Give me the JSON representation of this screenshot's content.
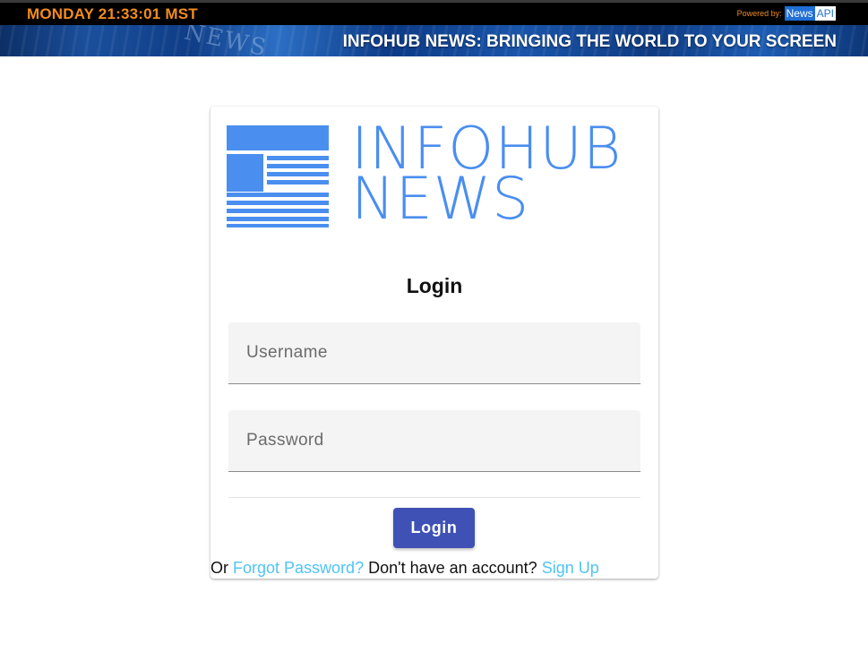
{
  "topbar": {
    "clock": "MONDAY 21:33:01 MST",
    "powered_by": "Powered by:",
    "newsapi_part1": "News",
    "newsapi_part2": "API"
  },
  "banner": {
    "background_word": "NEWS",
    "title": "INFOHUB NEWS: BRINGING THE WORLD TO YOUR SCREEN"
  },
  "logo": {
    "line1": "INFOHUB",
    "line2": "NEWS",
    "icon": "newspaper-icon"
  },
  "login": {
    "title": "Login",
    "username_placeholder": "Username",
    "password_placeholder": "Password",
    "button_label": "Login"
  },
  "footer": {
    "or_text": "Or",
    "forgot_label": "Forgot Password?",
    "no_account_text": "Don't have an account?",
    "signup_label": "Sign Up"
  },
  "colors": {
    "clock": "#f28c1e",
    "logo_blue": "#4a8ef0",
    "button": "#3f51b5",
    "link": "#4fc3f7"
  }
}
